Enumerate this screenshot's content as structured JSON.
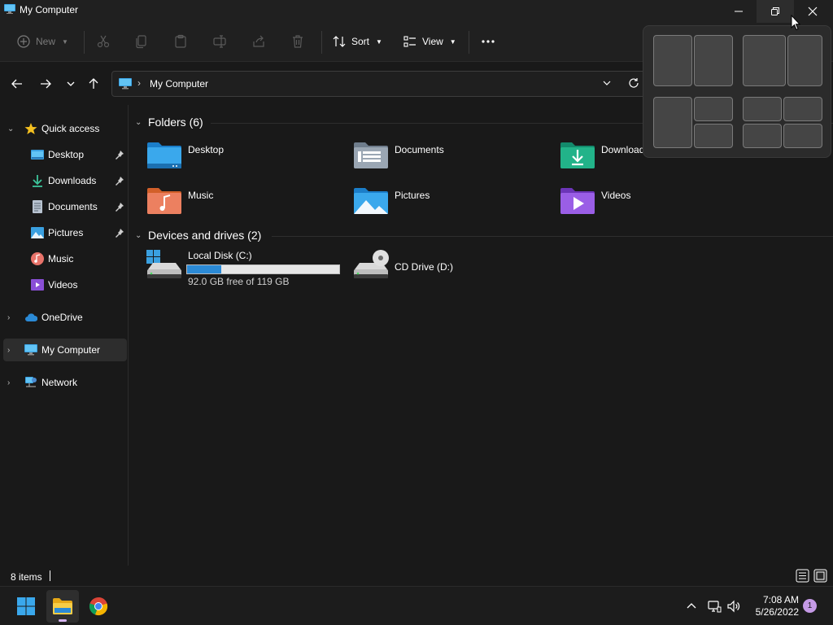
{
  "window": {
    "title": "My Computer"
  },
  "toolbar": {
    "new_label": "New",
    "sort_label": "Sort",
    "view_label": "View"
  },
  "address": {
    "path": "My Computer"
  },
  "sidebar": {
    "items": [
      {
        "label": "Quick access"
      },
      {
        "label": "Desktop"
      },
      {
        "label": "Downloads"
      },
      {
        "label": "Documents"
      },
      {
        "label": "Pictures"
      },
      {
        "label": "Music"
      },
      {
        "label": "Videos"
      },
      {
        "label": "OneDrive"
      },
      {
        "label": "My Computer"
      },
      {
        "label": "Network"
      }
    ]
  },
  "content": {
    "folders_header": "Folders (6)",
    "folders": [
      {
        "label": "Desktop"
      },
      {
        "label": "Documents"
      },
      {
        "label": "Downloads"
      },
      {
        "label": "Music"
      },
      {
        "label": "Pictures"
      },
      {
        "label": "Videos"
      }
    ],
    "drives_header": "Devices and drives (2)",
    "drives": [
      {
        "label": "Local Disk (C:)",
        "free_text": "92.0 GB free of 119 GB",
        "used_fraction": 0.227
      },
      {
        "label": "CD Drive (D:)"
      }
    ]
  },
  "status": {
    "count": "8 items"
  },
  "taskbar": {
    "time": "7:08 AM",
    "date": "5/26/2022",
    "notifications": "1"
  },
  "colors": {
    "accent": "#2b8ad6",
    "background": "#191919",
    "chrome": "#202020"
  }
}
